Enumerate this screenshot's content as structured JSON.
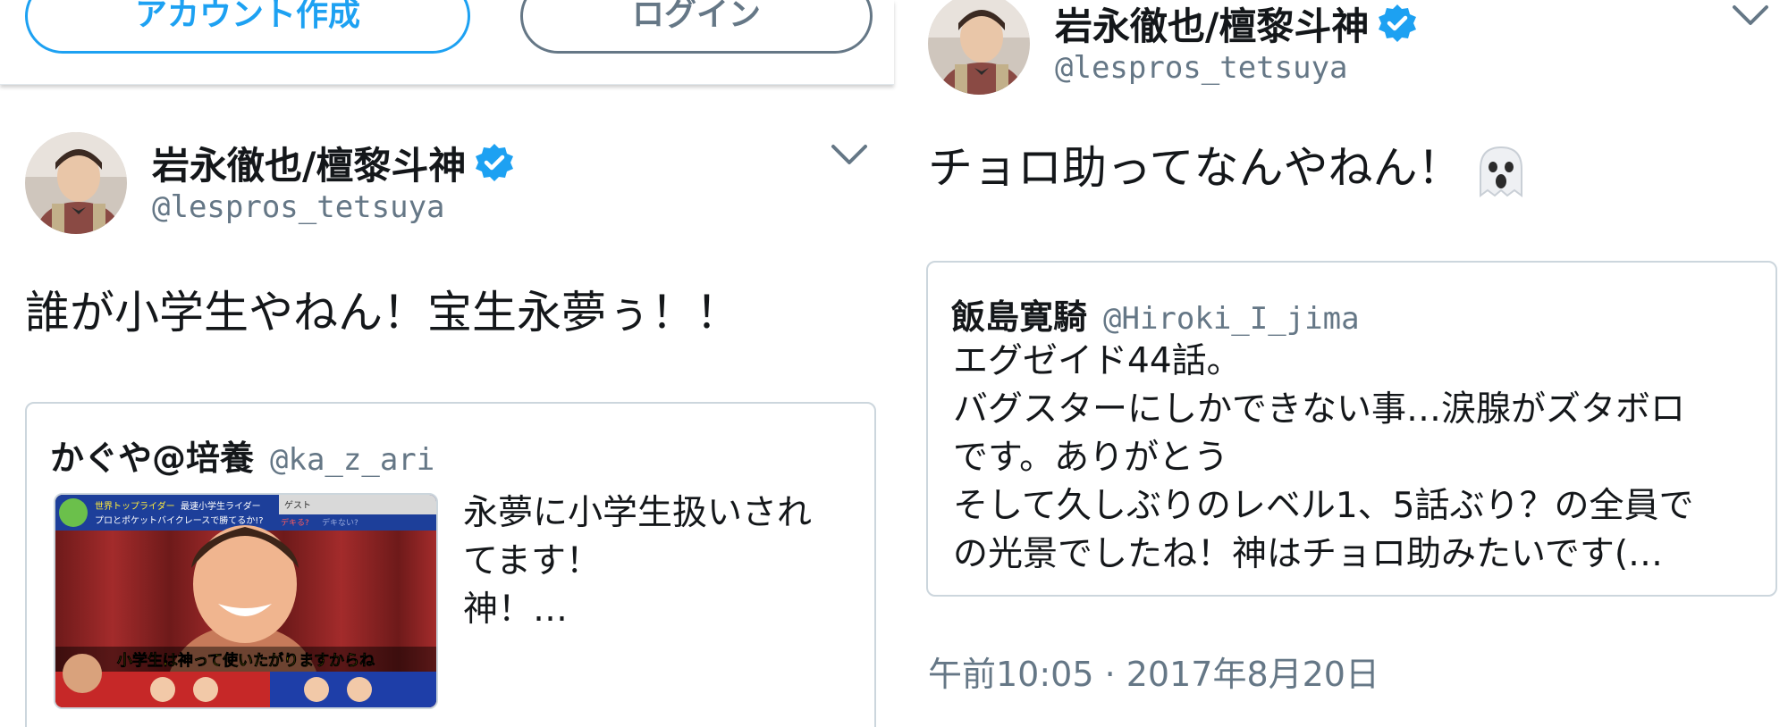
{
  "left": {
    "header": {
      "signup_label": "アカウント作成",
      "login_label": "ログイン"
    },
    "tweet": {
      "display_name": "岩永徹也/檀黎斗神",
      "handle": "@lespros_tetsuya",
      "text": "誰が小学生やねん！宝生永夢ぅ！！",
      "quote": {
        "display_name": "かぐや@培養",
        "handle": "@ka_z_ari",
        "text": "永夢に小学生扱いされ\nてます！\n神！…",
        "image_caption": "小学生は神って使いたがりますからね",
        "image_banner_left": "世界トップライダー",
        "image_banner_right": "最速小学生ライダー",
        "image_banner_sub": "プロとポケットバイクレースで勝てるか!?",
        "image_tag_guest": "ゲスト",
        "image_tag_dekiru": "デキる?",
        "image_tag_dekinai": "デキない?"
      }
    }
  },
  "right": {
    "tweet": {
      "display_name": "岩永徹也/檀黎斗神",
      "handle": "@lespros_tetsuya",
      "text": "チョロ助ってなんやねん！",
      "emoji_icon": "ghost-emoji",
      "quote": {
        "display_name": "飯島寛騎",
        "handle": "@Hiroki_I_jima",
        "text": "エグゼイド44話。\nバグスターにしかできない事…涙腺がズタボロ\nです。ありがとう\nそして久しぶりのレベル1、5話ぶり？の全員で\nの光景でしたね！神はチョロ助みたいです(…"
      },
      "timestamp": "午前10:05 · 2017年8月20日"
    }
  },
  "colors": {
    "accent": "#1da1f2",
    "secondary_text": "#657786",
    "border": "#ccd6dd"
  }
}
